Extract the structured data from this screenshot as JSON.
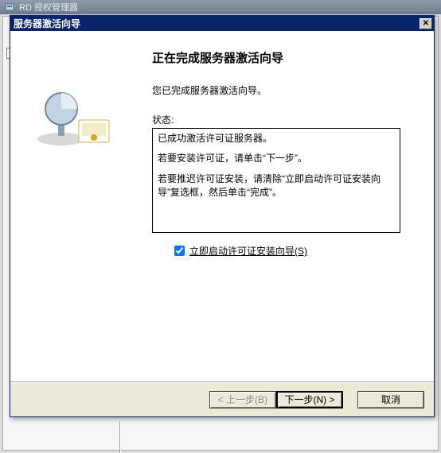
{
  "backWindow": {
    "title": "RD 授权管理器"
  },
  "wizard": {
    "title": "服务器激活向导",
    "heading": "正在完成服务器激活向导",
    "doneMsg": "您已完成服务器激活向导。",
    "statusLabel": "状态:",
    "status": {
      "line1": "已成功激活许可证服务器。",
      "line2": "若要安装许可证，请单击“下一步”。",
      "line3": "若要推迟许可证安装，请清除“立即启动许可证安装向导”复选框，然后单击“完成”。"
    },
    "checkbox": {
      "label": "立即启动许可证安装向导(S)",
      "checked": true
    },
    "buttons": {
      "back": "< 上一步(B)",
      "next": "下一步(N) >",
      "cancel": "取消"
    }
  }
}
